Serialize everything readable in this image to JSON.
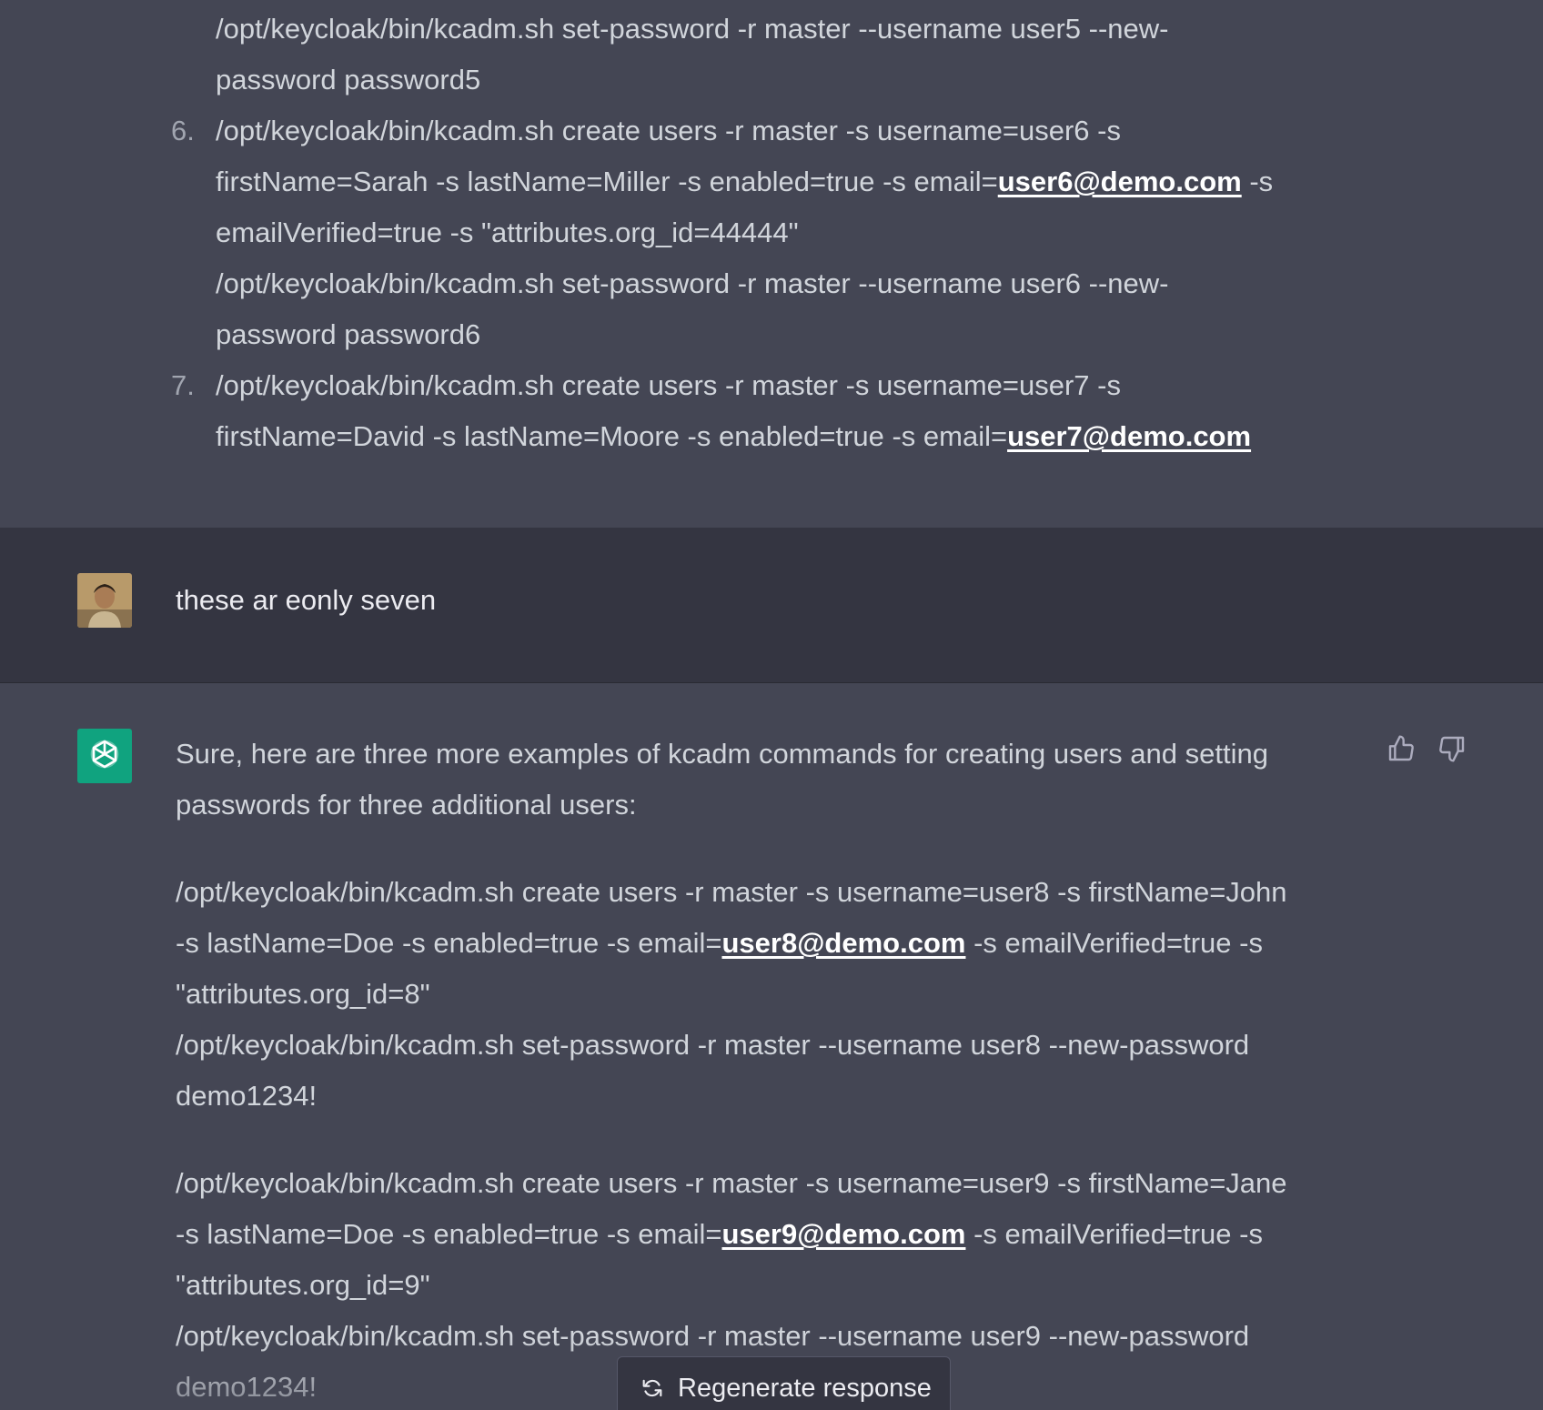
{
  "previous_message": {
    "lines": [
      "/opt/keycloak/bin/kcadm.sh set-password -r master --username user5 --new-",
      "password password5",
      "/opt/keycloak/bin/kcadm.sh create users -r master -s username=user6 -s",
      "firstName=Sarah -s lastName=Miller -s enabled=true -s email=",
      "emailVerified=true -s \"attributes.org_id=44444\"",
      "/opt/keycloak/bin/kcadm.sh set-password -r master --username user6 --new-",
      "password password6",
      "/opt/keycloak/bin/kcadm.sh create users -r master -s username=user7 -s",
      "firstName=David -s lastName=Moore -s enabled=true -s email="
    ],
    "after_email_6": " -s",
    "emails": [
      "user6@demo.com",
      "user7@demo.com"
    ],
    "numbers": [
      "6.",
      "7."
    ]
  },
  "user_message": {
    "text": "these ar eonly seven"
  },
  "assistant_message": {
    "intro_1": "Sure, here are three more examples of kcadm commands for creating users and setting",
    "intro_2": "passwords for three additional users:",
    "block8": {
      "l1": "/opt/keycloak/bin/kcadm.sh create users -r master -s username=user8 -s firstName=John",
      "l2a": "-s lastName=Doe -s enabled=true -s email=",
      "email": "user8@demo.com",
      "l2b": " -s emailVerified=true -s",
      "l3": "\"attributes.org_id=8\"",
      "l4": "/opt/keycloak/bin/kcadm.sh set-password -r master --username user8 --new-password",
      "l5": "demo1234!"
    },
    "block9": {
      "l1": "/opt/keycloak/bin/kcadm.sh create users -r master -s username=user9 -s firstName=Jane",
      "l2a": "-s lastName=Doe -s enabled=true -s email=",
      "email": "user9@demo.com",
      "l2b": " -s emailVerified=true -s",
      "l3": "\"attributes.org_id=9\"",
      "l4": "/opt/keycloak/bin/kcadm.sh set-password -r master --username user9 --new-password",
      "l5": "demo1234!"
    }
  },
  "regenerate": {
    "label": "Regenerate response"
  },
  "colors": {
    "assistant_bg": "#444654",
    "user_bg": "#343541",
    "brand_green": "#10a37f"
  },
  "icons": [
    "thumbs-up-icon",
    "thumbs-down-icon",
    "refresh-icon",
    "openai-logo-icon"
  ]
}
